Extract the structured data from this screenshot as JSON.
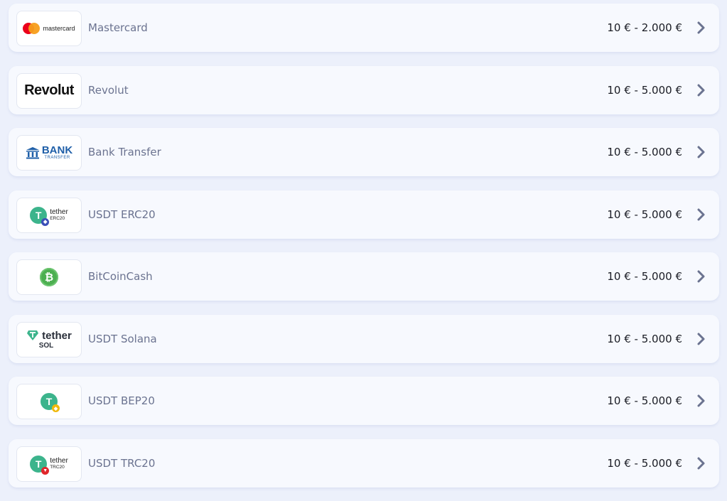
{
  "methods": [
    {
      "name": "Mastercard",
      "range": "10 € - 2.000 €",
      "logo_text": "mastercard",
      "logo": "mastercard-logo"
    },
    {
      "name": "Revolut",
      "range": "10 € - 5.000 €",
      "logo_text": "Revolut",
      "logo": "revolut-logo"
    },
    {
      "name": "Bank Transfer",
      "range": "10 € - 5.000 €",
      "logo_text": "BANK",
      "logo_subtext": "TRANSFER",
      "logo": "bank-logo"
    },
    {
      "name": "USDT ERC20",
      "range": "10 € - 5.000 €",
      "logo_text": "tether",
      "logo_subtext": "ERC20",
      "logo": "tether-erc20-logo"
    },
    {
      "name": "BitCoinCash",
      "range": "10 € - 5.000 €",
      "logo": "bitcoin-cash-logo"
    },
    {
      "name": "USDT Solana",
      "range": "10 € - 5.000 €",
      "logo_text": "tether",
      "logo_subtext": "SOL",
      "logo": "tether-sol-logo"
    },
    {
      "name": "USDT BEP20",
      "range": "10 € - 5.000 €",
      "logo": "tether-bep20-logo"
    },
    {
      "name": "USDT TRC20",
      "range": "10 € - 5.000 €",
      "logo_text": "tether",
      "logo_subtext": "TRC20",
      "logo": "tether-trc20-logo"
    }
  ],
  "colors": {
    "background": "#ecf0fb",
    "card": "#f7f9fe",
    "name_text": "#6b7390",
    "range_text": "#1a1c24",
    "chevron": "#6b7390",
    "tether_green": "#3cb48c",
    "bank_blue": "#1f5fa8"
  },
  "icons": {
    "chevron": "chevron-right-icon"
  }
}
